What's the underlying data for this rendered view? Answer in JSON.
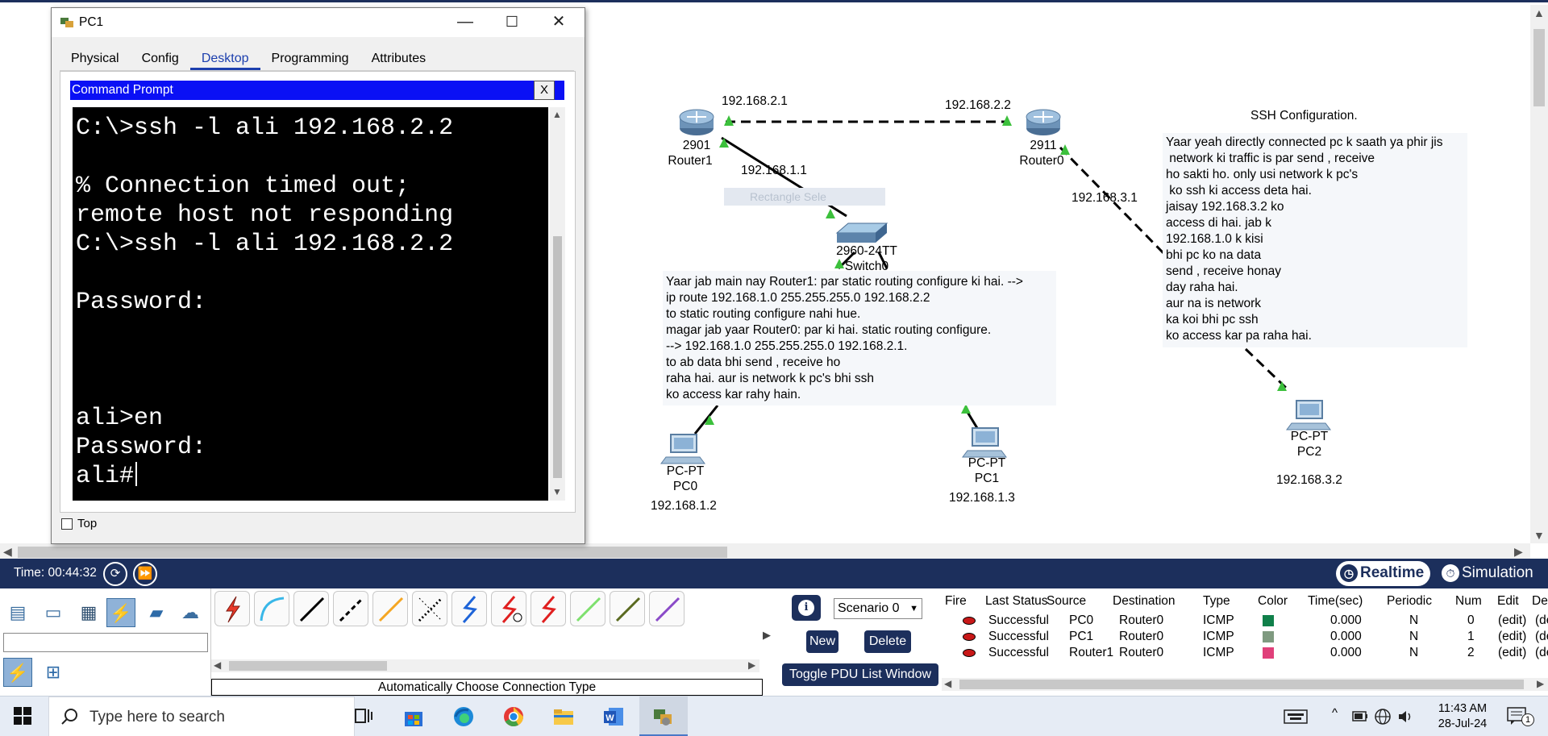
{
  "window": {
    "title": "PC1",
    "tabs": [
      "Physical",
      "Config",
      "Desktop",
      "Programming",
      "Attributes"
    ],
    "active_tab": "Desktop",
    "minimize": "—",
    "maximize": "☐",
    "close": "✕",
    "top_checkbox_label": "Top"
  },
  "cmd": {
    "title": "Command Prompt",
    "close": "X",
    "lines": [
      "C:\\>ssh -l ali 192.168.2.2",
      "",
      "% Connection timed out;",
      "remote host not responding",
      "C:\\>ssh -l ali 192.168.2.2",
      "",
      "Password:",
      "",
      "",
      "",
      "ali>en",
      "Password:",
      "ali#"
    ]
  },
  "topology": {
    "router1": {
      "model": "2901",
      "name": "Router1"
    },
    "router0": {
      "model": "2911",
      "name": "Router0"
    },
    "switch": {
      "model": "2960-24TT",
      "name": "Switch0"
    },
    "pc0": {
      "model": "PC-PT",
      "name": "PC0",
      "ip": "192.168.1.2"
    },
    "pc1": {
      "model": "PC-PT",
      "name": "PC1",
      "ip": "192.168.1.3"
    },
    "pc2": {
      "model": "PC-PT",
      "name": "PC2",
      "ip": "192.168.3.2"
    },
    "link_ips": {
      "r1_serial": "192.168.2.1",
      "r0_serial": "192.168.2.2",
      "r1_lan": "192.168.1.1",
      "r0_lan": "192.168.3.1"
    },
    "ghost_rect": "Rectangle Sele",
    "note_left": [
      "Yaar jab main nay Router1: par static routing configure ki hai. -->",
      "ip route 192.168.1.0 255.255.255.0 192.168.2.2",
      "to static routing configure nahi hue.",
      "magar jab yaar Router0: par ki hai. static routing configure.",
      "--> 192.168.1.0 255.255.255.0 192.168.2.1.",
      "to ab data bhi send , receive ho",
      "raha hai. aur is network k pc's bhi ssh",
      "ko access kar rahy hain."
    ],
    "ssh_title": "SSH Configuration.",
    "note_right": [
      "Yaar yeah directly connected pc k saath ya phir jis",
      " network ki traffic is par send , receive",
      "ho sakti ho. only usi network k pc's",
      " ko ssh ki access deta hai.",
      "jaisay 192.168.3.2 ko",
      "access di hai. jab k",
      "192.168.1.0 k kisi",
      "bhi pc ko na data",
      "send , receive honay",
      "day raha hai.",
      "aur na is network",
      "ka koi bhi pc ssh",
      "ko access kar pa raha hai."
    ]
  },
  "timebar": {
    "time": "Time: 00:44:32",
    "realtime": "Realtime",
    "simulation": "Simulation"
  },
  "connections": {
    "caption": "Automatically Choose Connection Type"
  },
  "scenario": {
    "info": "i",
    "selected": "Scenario 0",
    "new": "New",
    "delete": "Delete",
    "toggle": "Toggle PDU List Window"
  },
  "pdu": {
    "headers": [
      "Fire",
      "Last Status",
      "Source",
      "Destination",
      "Type",
      "Color",
      "Time(sec)",
      "Periodic",
      "Num",
      "Edit",
      "Delete"
    ],
    "rows": [
      {
        "status": "Successful",
        "source": "PC0",
        "dest": "Router0",
        "type": "ICMP",
        "color": "#10804a",
        "time": "0.000",
        "periodic": "N",
        "num": "0",
        "edit": "(edit)",
        "del": "(del..."
      },
      {
        "status": "Successful",
        "source": "PC1",
        "dest": "Router0",
        "type": "ICMP",
        "color": "#7f9a80",
        "time": "0.000",
        "periodic": "N",
        "num": "1",
        "edit": "(edit)",
        "del": "(del..."
      },
      {
        "status": "Successful",
        "source": "Router1",
        "dest": "Router0",
        "type": "ICMP",
        "color": "#e0407a",
        "time": "0.000",
        "periodic": "N",
        "num": "2",
        "edit": "(edit)",
        "del": "(del..."
      }
    ]
  },
  "taskbar": {
    "search_placeholder": "Type here to search",
    "time": "11:43 AM",
    "date": "28-Jul-24",
    "notifications": "1"
  },
  "colors": {
    "navy": "#1c2f5c",
    "cmd_title": "#0a10f5",
    "link_green": "#3cc03c"
  }
}
